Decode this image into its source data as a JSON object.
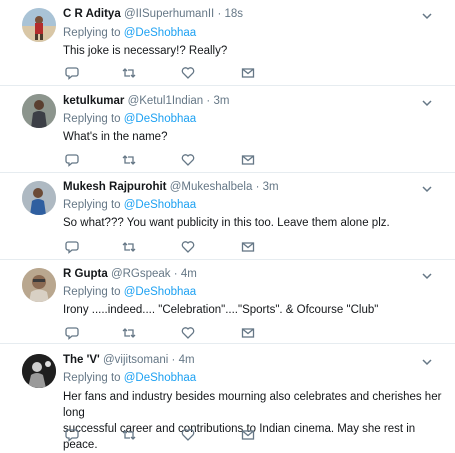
{
  "tweets": [
    {
      "name": "C R Aditya",
      "handle": "@IISuperhumanII",
      "time": "18s",
      "reply_prefix": "Replying to",
      "reply_to": "@DeShobhaa",
      "text": "This joke is necessary!? Really?",
      "avatar_icon": "avatar-photo-beach"
    },
    {
      "name": "ketulkumar",
      "handle": "@Ketul1Indian",
      "time": "3m",
      "reply_prefix": "Replying to",
      "reply_to": "@DeShobhaa",
      "text": "What's in the name?",
      "avatar_icon": "avatar-photo-person"
    },
    {
      "name": "Mukesh Rajpurohit",
      "handle": "@Mukeshalbela",
      "time": "3m",
      "reply_prefix": "Replying to",
      "reply_to": "@DeShobhaa",
      "text": "So what??? You want publicity in this too. Leave them alone plz.",
      "avatar_icon": "avatar-photo-person"
    },
    {
      "name": "R Gupta",
      "handle": "@RGspeak",
      "time": "4m",
      "reply_prefix": "Replying to",
      "reply_to": "@DeShobhaa",
      "text": "Irony .....indeed.... \"Celebration\"....\"Sports\".  & Ofcourse \"Club\"",
      "avatar_icon": "avatar-photo-person"
    },
    {
      "name": "The 'V'",
      "handle": "@vijitsomani",
      "time": "4m",
      "reply_prefix": "Replying to",
      "reply_to": "@DeShobhaa",
      "text_lines": [
        "Her fans and industry besides mourning also celebrates and cherishes her long",
        "successful career and contributions to Indian cinema. May she rest in peace."
      ],
      "avatar_icon": "avatar-photo-person"
    }
  ],
  "separator": "·",
  "colors": {
    "link": "#1da1f2",
    "secondary_text": "#657786",
    "icon": "#657786",
    "divider": "#e6ecf0"
  }
}
